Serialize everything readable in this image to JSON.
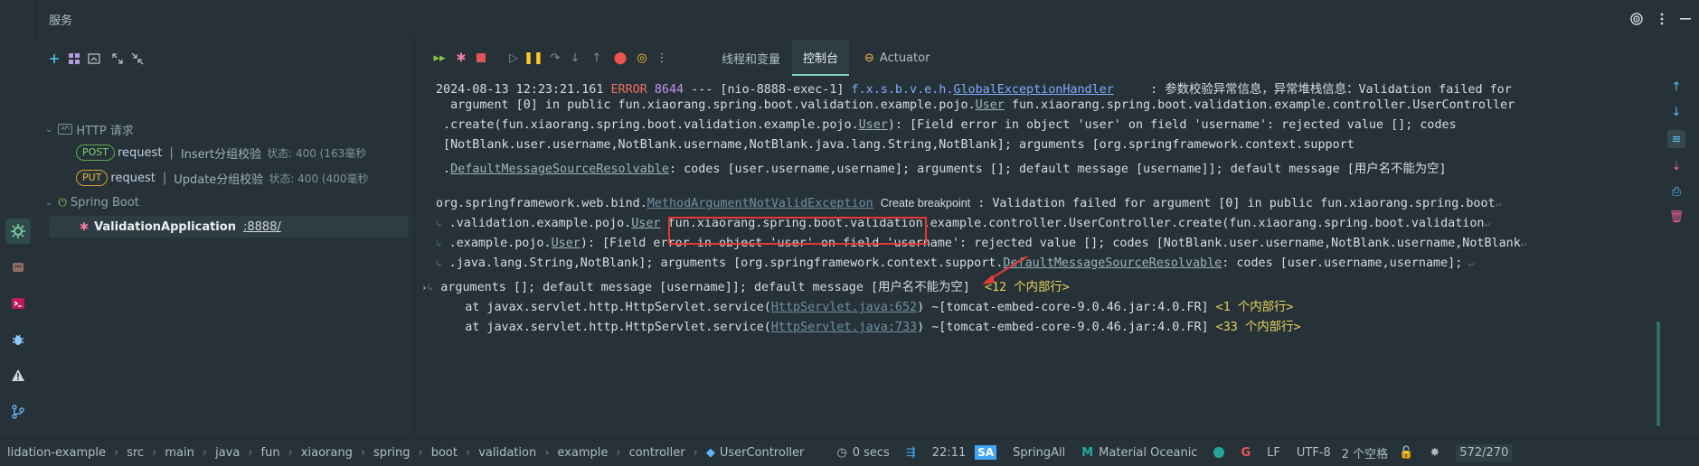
{
  "window": {
    "title": "服务"
  },
  "services_panel": {
    "tree": {
      "http_group": "HTTP 请求",
      "requests": [
        {
          "method": "POST",
          "name": "request",
          "sep": "|",
          "desc": "Insert分组校验",
          "status": "状态: 400 (163毫秒"
        },
        {
          "method": "PUT",
          "name": "request",
          "sep": "|",
          "desc": "Update分组校验",
          "status": "状态: 400 (400毫秒"
        }
      ],
      "spring_group": "Spring Boot",
      "app_name": "ValidationApplication",
      "app_port": ":8888/"
    }
  },
  "console": {
    "tabs": [
      {
        "label": "线程和变量"
      },
      {
        "label": "控制台"
      },
      {
        "label": "Actuator"
      }
    ],
    "lines": {
      "l1_ts": "2024-08-13 12:23:21.161 ",
      "l1_level": "ERROR",
      "l1_pid": " 8644",
      "l1_mid": " --- [nio-8888-exec-1] ",
      "l1_logger_pre": "f.x.s.b.v.e.h.",
      "l1_logger_cls": "GlobalExceptionHandler",
      "l1_msg": "     : 参数校验异常信息，异常堆栈信息：Validation failed for",
      "l2_pre": "  argument [0] in public fun.xiaorang.spring.boot.validation.example.pojo.",
      "l2_link": "User",
      "l2_post": " fun.xiaorang.spring.boot.validation.example.controller.UserController",
      "l3_pre": " .create(fun.xiaorang.spring.boot.validation.example.pojo.",
      "l3_link": "User",
      "l3_post": "): [Field error in object 'user' on field 'username': rejected value []; codes",
      "l4": " [NotBlank.user.username,NotBlank.username,NotBlank.java.lang.String,NotBlank]; arguments [org.springframework.context.support",
      "l5_pre": " .",
      "l5_link": "DefaultMessageSourceResolvable",
      "l5_post": ": codes [user.username,username]; arguments []; default message [username]]; default message [用户名不能为空]",
      "l6_pre": "org.springframework.web.bind.",
      "l6_link": "MethodArgumentNotValidException",
      "l6_hint": "Create breakpoint",
      "l6_post": " : Validation failed for argument [0] in public fun.xiaorang.spring.boot",
      "l7_pre": " .validation.example.pojo.",
      "l7_link": "User",
      "l7_post": " fun.xiaorang.spring.boot.validation.example.controller.UserController.create(fun.xiaorang.spring.boot.validation",
      "l8_pre": " .example.pojo.",
      "l8_link": "User",
      "l8_post": "): [Field error in object 'user' on field 'username': rejected value []; codes [NotBlank.user.username,NotBlank.username,NotBlank",
      "l9_pre": " .java.lang.String,NotBlank]; arguments [org.springframework.context.support.",
      "l9_link": "DefaultMessageSourceResolvable",
      "l9_post": ": codes [user.username,username];",
      "l10": " arguments []; default message [username]]; default message [用户名不能为空]",
      "l10_fold": "<12 个内部行>",
      "l11_pre": "    at javax.servlet.http.HttpServlet.service(",
      "l11_link": "HttpServlet.java:652",
      "l11_post": ") ~[tomcat-embed-core-9.0.46.jar:4.0.FR] ",
      "l11_fold": "<1 个内部行>",
      "l12_pre": "    at javax.servlet.http.HttpServlet.service(",
      "l12_link": "HttpServlet.java:733",
      "l12_post": ") ~[tomcat-embed-core-9.0.46.jar:4.0.FR] ",
      "l12_fold": "<33 个内部行>"
    }
  },
  "statusbar": {
    "breadcrumbs": [
      "lidation-example",
      "src",
      "main",
      "java",
      "fun",
      "xiaorang",
      "spring",
      "boot",
      "validation",
      "example",
      "controller",
      "UserController"
    ],
    "timer": "0 secs",
    "caret": "22:11",
    "user_badge": "SA",
    "spring_label": "SpringAll",
    "theme": "Material Oceanic",
    "line_sep": "LF",
    "encoding": "UTF-8",
    "indent": "2 个空格",
    "memory": "572/270"
  },
  "colors": {
    "background": "#263238",
    "accent": "#80cbc4",
    "error": "#ef6c5f",
    "highlight_box": "#e53935"
  }
}
